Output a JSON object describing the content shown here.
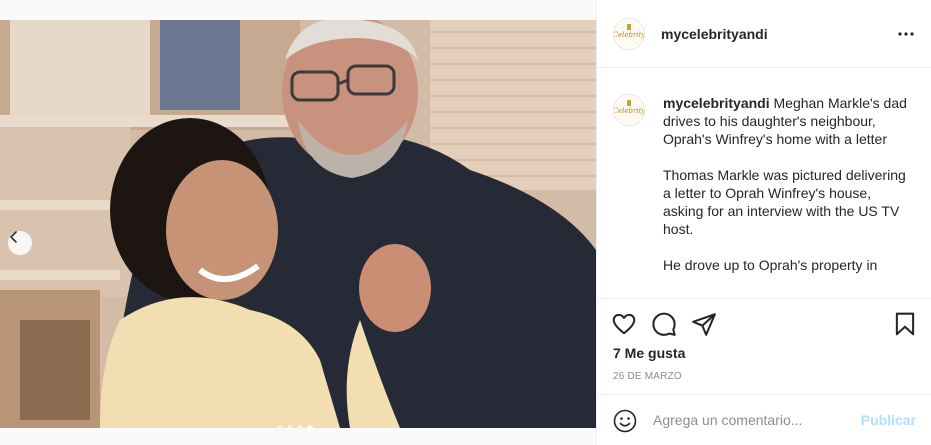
{
  "post": {
    "username": "mycelebrityandi",
    "avatar_text": "Celebrity",
    "caption": {
      "username": "mycelebrityandi",
      "paragraphs": [
        "Meghan Markle's dad drives to his daughter's neighbour, Oprah's Winfrey's home with a letter",
        "Thomas Markle was pictured delivering a letter to Oprah Winfrey's house, asking for an interview with the US TV host.",
        "He drove up to Oprah's property in"
      ]
    },
    "likes": "7 Me gusta",
    "date": "26 DE MARZO",
    "comment_placeholder": "Agrega un comentario...",
    "publish_label": "Publicar",
    "carousel": {
      "total": 4,
      "active": 4
    }
  },
  "colors": {
    "accent_disabled": "#b2dffc",
    "border": "#efefef",
    "muted": "#8e8e8e"
  },
  "icons": {
    "more": "more-options-icon",
    "like": "heart-icon",
    "comment": "comment-icon",
    "share": "share-icon",
    "save": "bookmark-icon",
    "emoji": "emoji-icon",
    "prev": "chevron-left-icon"
  }
}
